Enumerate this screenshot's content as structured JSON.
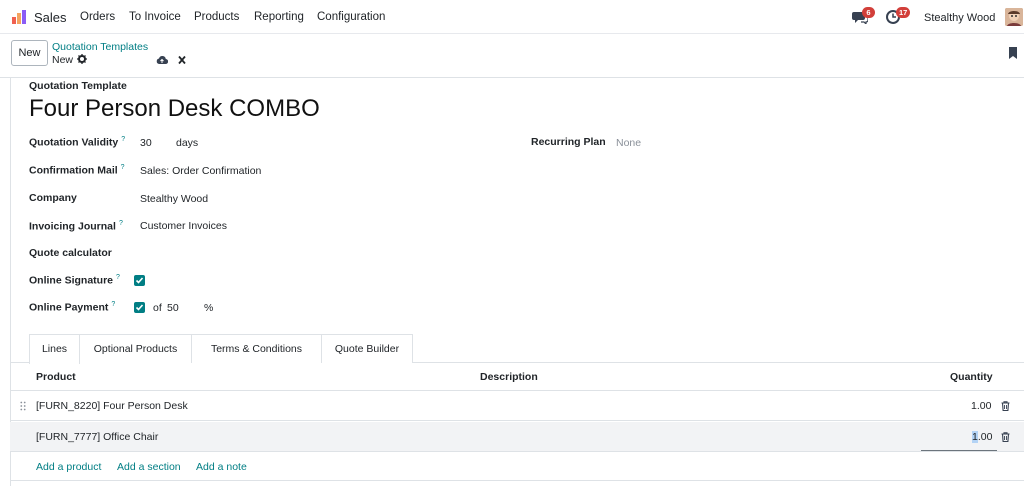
{
  "navbar": {
    "app_name": "Sales",
    "menu": [
      "Orders",
      "To Invoice",
      "Products",
      "Reporting",
      "Configuration"
    ],
    "messages_count": "6",
    "activities_count": "17",
    "user_name": "Stealthy Wood"
  },
  "control": {
    "new_label": "New",
    "breadcrumb_parent": "Quotation Templates",
    "breadcrumb_current": "New"
  },
  "form": {
    "model_label": "Quotation Template",
    "name": "Four Person Desk COMBO",
    "fields": {
      "validity_label": "Quotation Validity",
      "validity_value": "30",
      "validity_unit": "days",
      "recurring_label": "Recurring Plan",
      "recurring_value": "None",
      "mail_label": "Confirmation Mail",
      "mail_value": "Sales: Order Confirmation",
      "company_label": "Company",
      "company_value": "Stealthy Wood",
      "journal_label": "Invoicing Journal",
      "journal_value": "Customer Invoices",
      "calculator_label": "Quote calculator",
      "signature_label": "Online Signature",
      "signature_checked": true,
      "payment_label": "Online Payment",
      "payment_checked": true,
      "payment_of": "of",
      "payment_percent": "50",
      "payment_unit": "%",
      "help_mark": "?"
    }
  },
  "tabs": [
    "Lines",
    "Optional Products",
    "Terms & Conditions",
    "Quote Builder"
  ],
  "active_tab": "Lines",
  "table": {
    "headers": {
      "product": "Product",
      "description": "Description",
      "quantity": "Quantity"
    },
    "rows": [
      {
        "product": "[FURN_8220] Four Person Desk",
        "description": "",
        "quantity": "1.00"
      },
      {
        "product": "[FURN_7777] Office Chair",
        "description": "",
        "quantity_selected": "1",
        "quantity_rest": ".00"
      }
    ],
    "add_links": {
      "product": "Add a product",
      "section": "Add a section",
      "note": "Add a note"
    }
  },
  "colors": {
    "accent": "#017e84",
    "badge": "#d23f3a"
  }
}
